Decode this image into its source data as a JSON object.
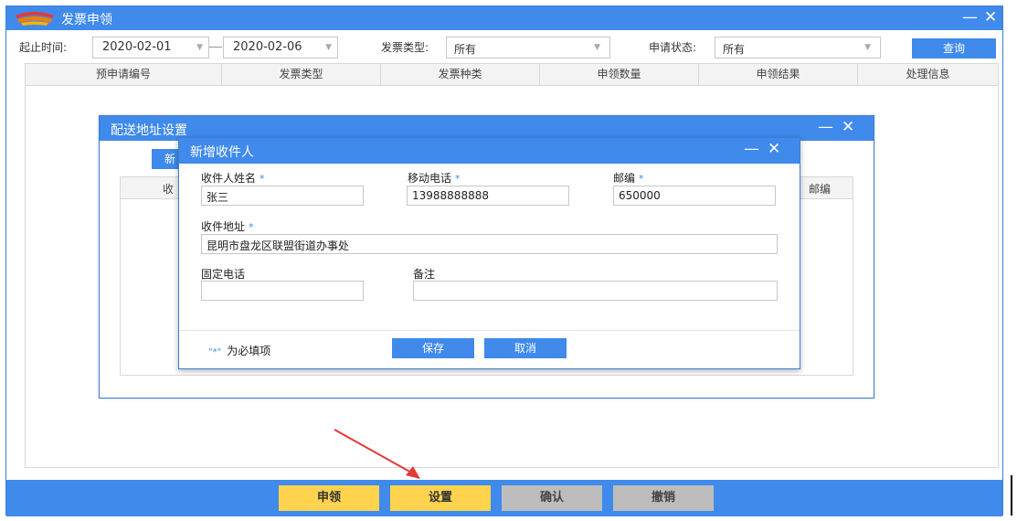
{
  "window": {
    "title": "发票申领"
  },
  "filter": {
    "time_label": "起止时间:",
    "start_date": "2020-02-01",
    "end_date": "2020-02-06",
    "invoice_type_label": "发票类型:",
    "invoice_type_value": "所有",
    "status_label": "申请状态:",
    "status_value": "所有",
    "query_label": "查询"
  },
  "grid": {
    "columns": [
      "预申请编号",
      "发票类型",
      "发票种类",
      "申领数量",
      "申领结果",
      "处理信息"
    ]
  },
  "bottom": {
    "apply_label": "申领",
    "settings_label": "设置",
    "confirm_label": "确认",
    "revoke_label": "撤销"
  },
  "address_dialog": {
    "title": "配送地址设置",
    "new_button_label": "新",
    "col_receiver": "收",
    "col_zip": "邮编"
  },
  "recipient_dialog": {
    "title": "新增收件人",
    "required_mark": "*",
    "name_label": "收件人姓名",
    "name_value": "张三",
    "mobile_label": "移动电话",
    "mobile_value": "13988888888",
    "zip_label": "邮编",
    "zip_value": "650000",
    "address_label": "收件地址",
    "address_value": "昆明市盘龙区联盟街道办事处",
    "phone_label": "固定电话",
    "phone_value": "",
    "remark_label": "备注",
    "remark_value": "",
    "note_mark": "\"*\"",
    "note_text": "为必填项",
    "save_label": "保存",
    "cancel_label": "取消"
  },
  "colors": {
    "accent": "#3f8aeb",
    "yellow_button": "#ffd34e",
    "disabled_button": "#bdbdbd",
    "annotation_arrow": "#e53935"
  },
  "icons": {
    "logo": "app-logo-icon",
    "minimize": "minimize-icon",
    "close": "close-icon",
    "dropdown": "chevron-down-icon"
  }
}
